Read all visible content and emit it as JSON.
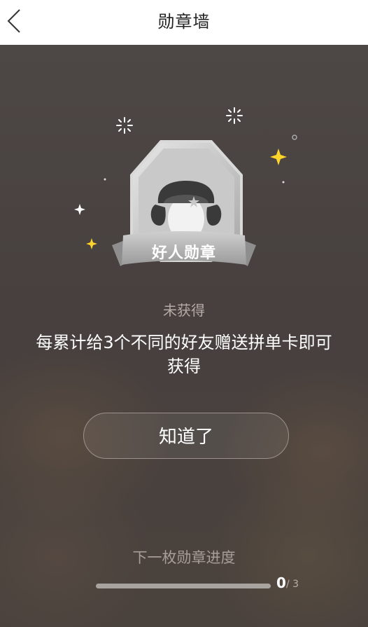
{
  "header": {
    "title": "勋章墙",
    "back_icon": "chevron-left-icon",
    "background": "#ffffff"
  },
  "badge": {
    "name": "好人勋章",
    "status": "未获得",
    "description": "每累计给3个不同的好友赠送拼单卡即可获得",
    "icon": "hat-person-badge-icon"
  },
  "dialog": {
    "ok_label": "知道了"
  },
  "next_badge": {
    "title": "下一枚勋章进度",
    "current": "0",
    "total": "/ 3",
    "progress": 0
  },
  "colors": {
    "overlay": "#4a4442",
    "sparkle_yellow": "#ffd52b",
    "text_muted": "#b5aba6"
  }
}
